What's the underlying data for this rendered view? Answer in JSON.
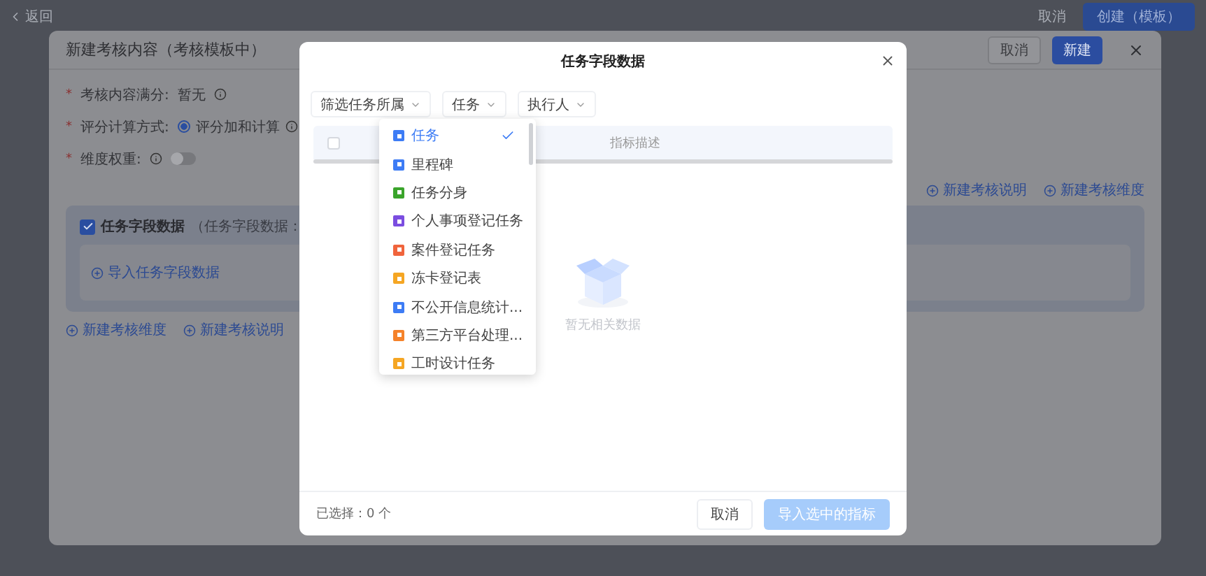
{
  "page": {
    "back": "返回",
    "cancel": "取消",
    "create": "创建（模板）"
  },
  "editor": {
    "title": "新建考核内容（考核模板中）",
    "cancel": "取消",
    "confirm": "新建",
    "full_score": {
      "mark": "*",
      "label": "考核内容满分:",
      "value": "暂无"
    },
    "scoring": {
      "mark": "*",
      "label": "评分计算方式:",
      "options": [
        {
          "label": "评分加和计算",
          "selected": true
        }
      ]
    },
    "weight": {
      "mark": "*",
      "label": "维度权重:",
      "on": false
    },
    "top_links": [
      "新建考核说明",
      "新建考核维度"
    ],
    "section": {
      "title": "任务字段数据",
      "note": "（任务字段数据：",
      "checked": true,
      "import_link": "导入任务字段数据"
    },
    "bottom_links": [
      "新建考核维度",
      "新建考核说明"
    ]
  },
  "dialog": {
    "title": "任务字段数据",
    "filters": [
      {
        "label": "筛选任务所属"
      },
      {
        "label": "任务"
      },
      {
        "label": "执行人"
      }
    ],
    "select_all": {
      "checked": false
    },
    "columns": [
      "指标描述"
    ],
    "empty": "暂无相关数据",
    "selected_count": "已选择：0 个",
    "cancel": "取消",
    "import": {
      "label": "导入选中的指标",
      "disabled": true
    }
  },
  "dropdown": {
    "items": [
      {
        "label": "任务",
        "color": "#3d7cf5",
        "selected": true
      },
      {
        "label": "里程碑",
        "color": "#3d7cf5",
        "selected": false
      },
      {
        "label": "任务分身",
        "color": "#3aa42b",
        "selected": false
      },
      {
        "label": "个人事项登记任务",
        "color": "#7b4de0",
        "selected": false
      },
      {
        "label": "案件登记任务",
        "color": "#f0643c",
        "selected": false
      },
      {
        "label": "冻卡登记表",
        "color": "#f5a623",
        "selected": false
      },
      {
        "label": "不公开信息统计...",
        "color": "#3d7cf5",
        "selected": false
      },
      {
        "label": "第三方平台处理...",
        "color": "#f5822a",
        "selected": false
      },
      {
        "label": "工时设计任务",
        "color": "#f5a623",
        "selected": false
      }
    ]
  }
}
